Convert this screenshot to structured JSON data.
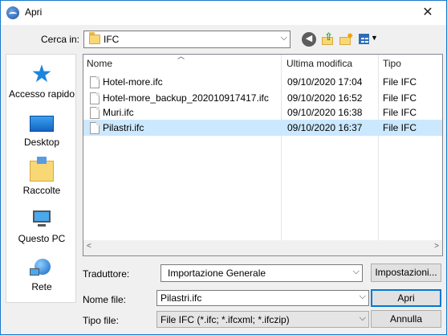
{
  "window": {
    "title": "Apri",
    "close_glyph": "✕"
  },
  "lookin": {
    "label": "Cerca in:",
    "value": "IFC"
  },
  "places": [
    {
      "label": "Accesso rapido",
      "icon": "star-icon"
    },
    {
      "label": "Desktop",
      "icon": "desktop-icon"
    },
    {
      "label": "Raccolte",
      "icon": "libraries-icon"
    },
    {
      "label": "Questo PC",
      "icon": "computer-icon"
    },
    {
      "label": "Rete",
      "icon": "network-icon"
    }
  ],
  "columns": {
    "name": "Nome",
    "modified": "Ultima modifica",
    "type": "Tipo"
  },
  "files": [
    {
      "name": "Hotel-more.ifc",
      "modified": "09/10/2020 17:04",
      "type": "File IFC",
      "selected": false
    },
    {
      "name": "Hotel-more_backup_202010917417.ifc",
      "modified": "09/10/2020 16:52",
      "type": "File IFC",
      "selected": false
    },
    {
      "name": "Muri.ifc",
      "modified": "09/10/2020 16:38",
      "type": "File IFC",
      "selected": false
    },
    {
      "name": "Pilastri.ifc",
      "modified": "09/10/2020 16:37",
      "type": "File IFC",
      "selected": true
    }
  ],
  "translator": {
    "label": "Traduttore:",
    "value": "Importazione Generale",
    "settings_button": "Impostazioni..."
  },
  "filename": {
    "label": "Nome file:",
    "value": "Pilastri.ifc"
  },
  "filetype": {
    "label": "Tipo file:",
    "value": "File IFC (*.ifc; *.ifcxml; *.ifczip)"
  },
  "buttons": {
    "open": "Apri",
    "cancel": "Annulla"
  },
  "colors": {
    "selection": "#cce8ff",
    "accent": "#0078d7"
  }
}
